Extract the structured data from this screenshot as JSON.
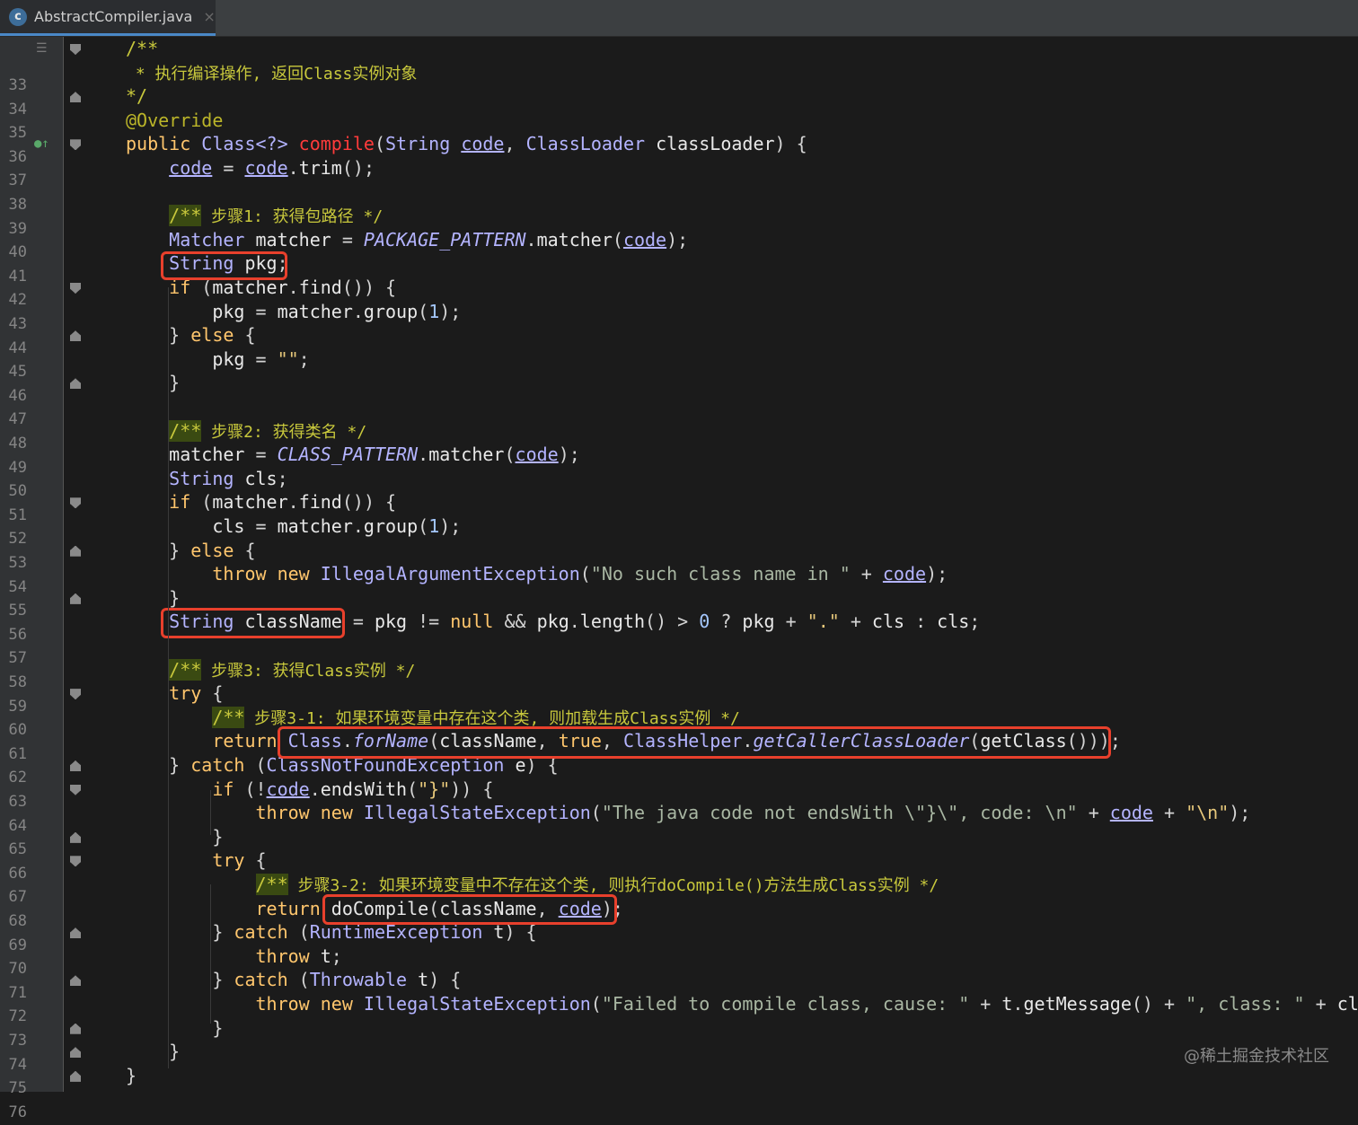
{
  "tab": {
    "icon": "c",
    "label": "AbstractCompiler.java",
    "close": "×"
  },
  "watermark": "@稀土掘金技术社区",
  "line_numbers": [
    "33",
    "34",
    "35",
    "36",
    "37",
    "38",
    "39",
    "40",
    "41",
    "42",
    "43",
    "44",
    "45",
    "46",
    "47",
    "48",
    "49",
    "50",
    "51",
    "52",
    "53",
    "54",
    "55",
    "56",
    "57",
    "58",
    "59",
    "60",
    "61",
    "62",
    "63",
    "64",
    "65",
    "66",
    "67",
    "68",
    "69",
    "70",
    "71",
    "72",
    "73",
    "74",
    "75",
    "76"
  ],
  "code_lines": [
    [
      [
        "cm",
        "/**"
      ]
    ],
    [
      [
        "cm",
        " * 执行编译操作, 返回Class实例对象"
      ]
    ],
    [
      [
        "cm",
        "*/"
      ]
    ],
    [
      [
        "an",
        "@Override"
      ]
    ],
    [
      [
        "kw",
        "public "
      ],
      [
        "ty",
        "Class<?> "
      ],
      [
        "fn",
        "compile"
      ],
      [
        "op",
        "("
      ],
      [
        "ty",
        "String "
      ],
      [
        "uvar",
        "code"
      ],
      [
        "op",
        ", "
      ],
      [
        "ty",
        "ClassLoader "
      ],
      [
        "var",
        "classLoader"
      ],
      [
        "op",
        ") {"
      ]
    ],
    [
      [
        "op",
        "    "
      ],
      [
        "uvar",
        "code"
      ],
      [
        "op",
        " = "
      ],
      [
        "uvar",
        "code"
      ],
      [
        "op",
        "."
      ],
      [
        "var",
        "trim"
      ],
      [
        "op",
        "();"
      ]
    ],
    [],
    [
      [
        "op",
        "    "
      ],
      [
        "cmh",
        "/**"
      ],
      [
        "cm",
        " 步骤1: 获得包路径 */"
      ]
    ],
    [
      [
        "op",
        "    "
      ],
      [
        "ty",
        "Matcher "
      ],
      [
        "var",
        "matcher"
      ],
      [
        "op",
        " = "
      ],
      [
        "it",
        "PACKAGE_PATTERN"
      ],
      [
        "op",
        "."
      ],
      [
        "var",
        "matcher"
      ],
      [
        "op",
        "("
      ],
      [
        "uvar",
        "code"
      ],
      [
        "op",
        ");"
      ]
    ],
    [
      [
        "op",
        "    "
      ],
      [
        "ty",
        "String "
      ],
      [
        "var",
        "pkg"
      ],
      [
        "op",
        ";"
      ]
    ],
    [
      [
        "op",
        "    "
      ],
      [
        "kw",
        "if "
      ],
      [
        "op",
        "("
      ],
      [
        "var",
        "matcher"
      ],
      [
        "op",
        "."
      ],
      [
        "var",
        "find"
      ],
      [
        "op",
        "()) {"
      ]
    ],
    [
      [
        "op",
        "        "
      ],
      [
        "var",
        "pkg"
      ],
      [
        "op",
        " = "
      ],
      [
        "var",
        "matcher"
      ],
      [
        "op",
        "."
      ],
      [
        "var",
        "group"
      ],
      [
        "op",
        "("
      ],
      [
        "num",
        "1"
      ],
      [
        "op",
        ");"
      ]
    ],
    [
      [
        "op",
        "    } "
      ],
      [
        "kw",
        "else "
      ],
      [
        "op",
        "{"
      ]
    ],
    [
      [
        "op",
        "        "
      ],
      [
        "var",
        "pkg"
      ],
      [
        "op",
        " = "
      ],
      [
        "st",
        "\"\""
      ],
      [
        "op",
        ";"
      ]
    ],
    [
      [
        "op",
        "    }"
      ]
    ],
    [],
    [
      [
        "op",
        "    "
      ],
      [
        "cmh",
        "/**"
      ],
      [
        "cm",
        " 步骤2: 获得类名 */"
      ]
    ],
    [
      [
        "op",
        "    "
      ],
      [
        "var",
        "matcher"
      ],
      [
        "op",
        " = "
      ],
      [
        "it",
        "CLASS_PATTERN"
      ],
      [
        "op",
        "."
      ],
      [
        "var",
        "matcher"
      ],
      [
        "op",
        "("
      ],
      [
        "uvar",
        "code"
      ],
      [
        "op",
        ");"
      ]
    ],
    [
      [
        "op",
        "    "
      ],
      [
        "ty",
        "String "
      ],
      [
        "var",
        "cls"
      ],
      [
        "op",
        ";"
      ]
    ],
    [
      [
        "op",
        "    "
      ],
      [
        "kw",
        "if "
      ],
      [
        "op",
        "("
      ],
      [
        "var",
        "matcher"
      ],
      [
        "op",
        "."
      ],
      [
        "var",
        "find"
      ],
      [
        "op",
        "()) {"
      ]
    ],
    [
      [
        "op",
        "        "
      ],
      [
        "var",
        "cls"
      ],
      [
        "op",
        " = "
      ],
      [
        "var",
        "matcher"
      ],
      [
        "op",
        "."
      ],
      [
        "var",
        "group"
      ],
      [
        "op",
        "("
      ],
      [
        "num",
        "1"
      ],
      [
        "op",
        ");"
      ]
    ],
    [
      [
        "op",
        "    } "
      ],
      [
        "kw",
        "else "
      ],
      [
        "op",
        "{"
      ]
    ],
    [
      [
        "op",
        "        "
      ],
      [
        "kw",
        "throw new "
      ],
      [
        "ty",
        "IllegalArgumentException"
      ],
      [
        "op",
        "("
      ],
      [
        "stx",
        "\"No such class name in \""
      ],
      [
        "op",
        " + "
      ],
      [
        "uvar",
        "code"
      ],
      [
        "op",
        ");"
      ]
    ],
    [
      [
        "op",
        "    }"
      ]
    ],
    [
      [
        "op",
        "    "
      ],
      [
        "ty",
        "String "
      ],
      [
        "var",
        "className"
      ],
      [
        "op",
        " = "
      ],
      [
        "var",
        "pkg"
      ],
      [
        "op",
        " != "
      ],
      [
        "kw",
        "null "
      ],
      [
        "op",
        "&& "
      ],
      [
        "var",
        "pkg"
      ],
      [
        "op",
        "."
      ],
      [
        "var",
        "length"
      ],
      [
        "op",
        "() > "
      ],
      [
        "num",
        "0"
      ],
      [
        "op",
        " ? "
      ],
      [
        "var",
        "pkg"
      ],
      [
        "op",
        " + "
      ],
      [
        "st",
        "\".\""
      ],
      [
        "op",
        " + "
      ],
      [
        "var",
        "cls"
      ],
      [
        "op",
        " : "
      ],
      [
        "var",
        "cls"
      ],
      [
        "op",
        ";"
      ]
    ],
    [],
    [
      [
        "op",
        "    "
      ],
      [
        "cmh",
        "/**"
      ],
      [
        "cm",
        " 步骤3: 获得Class实例 */"
      ]
    ],
    [
      [
        "op",
        "    "
      ],
      [
        "kw",
        "try "
      ],
      [
        "op",
        "{"
      ]
    ],
    [
      [
        "op",
        "        "
      ],
      [
        "cmh",
        "/**"
      ],
      [
        "cm",
        " 步骤3-1: 如果环境变量中存在这个类, 则加载生成Class实例 */"
      ]
    ],
    [
      [
        "op",
        "        "
      ],
      [
        "kw",
        "return "
      ],
      [
        "ty",
        "Class"
      ],
      [
        "op",
        "."
      ],
      [
        "it",
        "forName"
      ],
      [
        "op",
        "("
      ],
      [
        "var",
        "className"
      ],
      [
        "op",
        ", "
      ],
      [
        "kw",
        "true"
      ],
      [
        "op",
        ", "
      ],
      [
        "ty",
        "ClassHelper"
      ],
      [
        "op",
        "."
      ],
      [
        "it",
        "getCallerClassLoader"
      ],
      [
        "op",
        "("
      ],
      [
        "var",
        "getClass"
      ],
      [
        "op",
        "()));"
      ]
    ],
    [
      [
        "op",
        "    } "
      ],
      [
        "kw",
        "catch "
      ],
      [
        "op",
        "("
      ],
      [
        "ty",
        "ClassNotFoundException "
      ],
      [
        "var",
        "e"
      ],
      [
        "op",
        ") {"
      ]
    ],
    [
      [
        "op",
        "        "
      ],
      [
        "kw",
        "if "
      ],
      [
        "op",
        "(!"
      ],
      [
        "uvar",
        "code"
      ],
      [
        "op",
        "."
      ],
      [
        "var",
        "endsWith"
      ],
      [
        "op",
        "("
      ],
      [
        "st",
        "\"}\""
      ],
      [
        "op",
        ")) {"
      ]
    ],
    [
      [
        "op",
        "            "
      ],
      [
        "kw",
        "throw new "
      ],
      [
        "ty",
        "IllegalStateException"
      ],
      [
        "op",
        "("
      ],
      [
        "stx",
        "\"The java code not endsWith \\\"}\\\", code: \\n\""
      ],
      [
        "op",
        " + "
      ],
      [
        "uvar",
        "code"
      ],
      [
        "op",
        " + "
      ],
      [
        "st",
        "\"\\n\""
      ],
      [
        "op",
        ");"
      ]
    ],
    [
      [
        "op",
        "        }"
      ]
    ],
    [
      [
        "op",
        "        "
      ],
      [
        "kw",
        "try "
      ],
      [
        "op",
        "{"
      ]
    ],
    [
      [
        "op",
        "            "
      ],
      [
        "cmh",
        "/**"
      ],
      [
        "cm",
        " 步骤3-2: 如果环境变量中不存在这个类, 则执行doCompile()方法生成Class实例 */"
      ]
    ],
    [
      [
        "op",
        "            "
      ],
      [
        "kw",
        "return "
      ],
      [
        "var",
        "doCompile"
      ],
      [
        "op",
        "("
      ],
      [
        "var",
        "className"
      ],
      [
        "op",
        ", "
      ],
      [
        "uvar",
        "code"
      ],
      [
        "op",
        ");"
      ]
    ],
    [
      [
        "op",
        "        } "
      ],
      [
        "kw",
        "catch "
      ],
      [
        "op",
        "("
      ],
      [
        "ty",
        "RuntimeException "
      ],
      [
        "var",
        "t"
      ],
      [
        "op",
        ") {"
      ]
    ],
    [
      [
        "op",
        "            "
      ],
      [
        "kw",
        "throw "
      ],
      [
        "var",
        "t"
      ],
      [
        "op",
        ";"
      ]
    ],
    [
      [
        "op",
        "        } "
      ],
      [
        "kw",
        "catch "
      ],
      [
        "op",
        "("
      ],
      [
        "ty",
        "Throwable "
      ],
      [
        "var",
        "t"
      ],
      [
        "op",
        ") {"
      ]
    ],
    [
      [
        "op",
        "            "
      ],
      [
        "kw",
        "throw new "
      ],
      [
        "ty",
        "IllegalStateException"
      ],
      [
        "op",
        "("
      ],
      [
        "stx",
        "\"Failed to compile class, cause: \""
      ],
      [
        "op",
        " + "
      ],
      [
        "var",
        "t"
      ],
      [
        "op",
        "."
      ],
      [
        "var",
        "getMessage"
      ],
      [
        "op",
        "() + "
      ],
      [
        "stx",
        "\", class: \""
      ],
      [
        "op",
        " + "
      ],
      [
        "var",
        "clas"
      ]
    ],
    [
      [
        "op",
        "        }"
      ]
    ],
    [
      [
        "op",
        "    }"
      ]
    ],
    [
      [
        "op",
        "}"
      ]
    ]
  ],
  "fold_markers": {
    "33": "down",
    "35": "up",
    "37": "down",
    "43": "down",
    "45": "up",
    "47": "up",
    "52": "down",
    "54": "up",
    "56": "up",
    "60": "down",
    "63": "up",
    "64": "down",
    "66": "up",
    "67": "down",
    "70": "up",
    "72": "up",
    "74": "up",
    "75": "up",
    "76": "up"
  }
}
